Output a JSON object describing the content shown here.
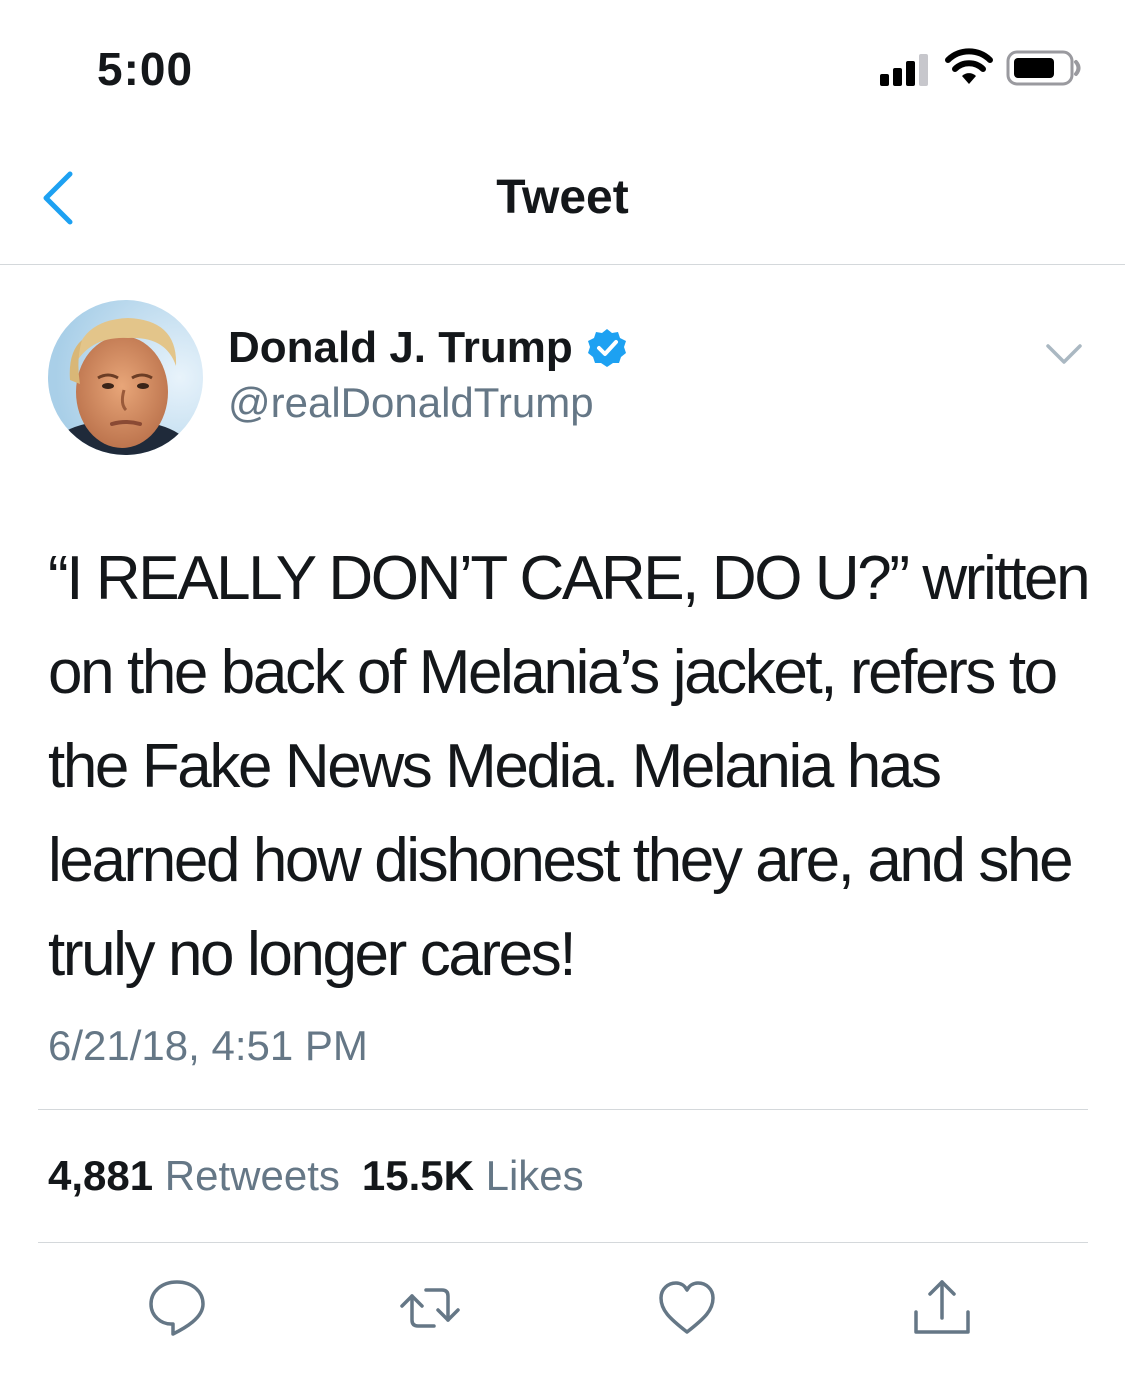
{
  "status_bar": {
    "time": "5:00",
    "signal_icon": "cellular-signal-icon",
    "wifi_icon": "wifi-icon",
    "battery_icon": "battery-icon"
  },
  "nav": {
    "title": "Tweet",
    "back_icon": "chevron-left-icon"
  },
  "tweet": {
    "author_name": "Donald J. Trump",
    "verified": true,
    "handle": "@realDonaldTrump",
    "text": "“I REALLY DON’T CARE, DO U?” written on the back of Melania’s jacket, refers to the Fake News Media. Melania has learned how dishonest they are, and she truly no longer cares!",
    "timestamp": "6/21/18, 4:51 PM",
    "retweets_count": "4,881",
    "retweets_label": "Retweets",
    "likes_count": "15.5K",
    "likes_label": "Likes"
  },
  "actions": [
    "reply-icon",
    "retweet-icon",
    "like-icon",
    "share-icon"
  ],
  "colors": {
    "accent": "#1da1f2",
    "text_primary": "#14171a",
    "text_secondary": "#657786",
    "divider": "#d4d8db"
  }
}
